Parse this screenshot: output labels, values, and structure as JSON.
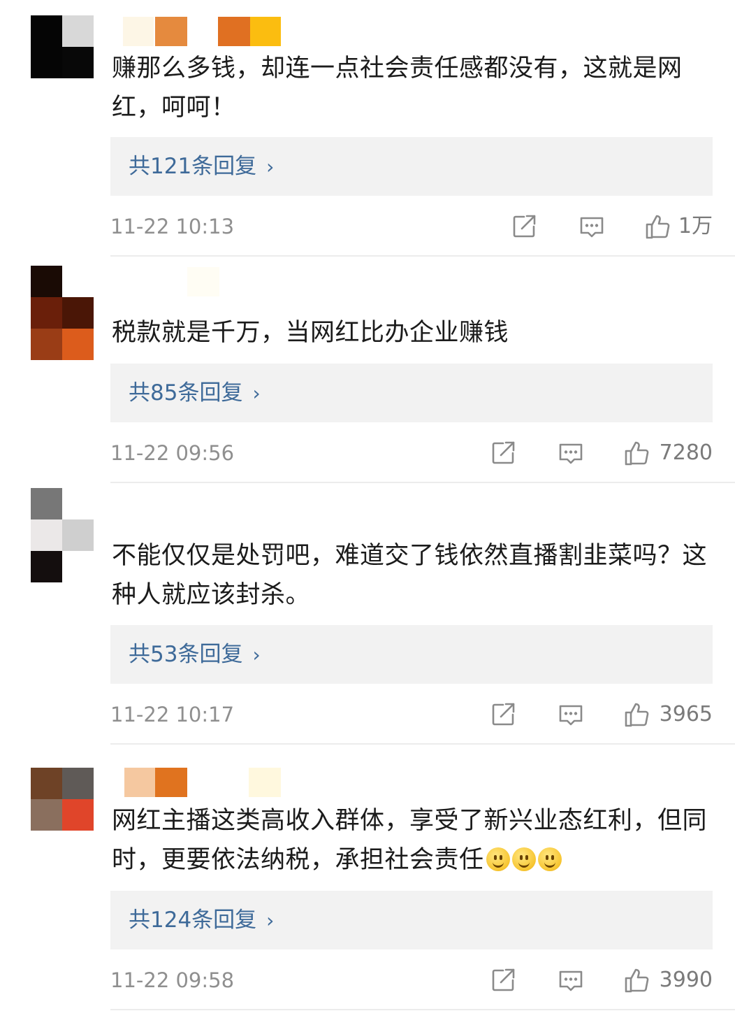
{
  "comments": [
    {
      "text": "赚那么多钱，却连一点社会责任感都没有，这就是网红，呵呵！",
      "reply_label": "共121条回复",
      "time": "11-22 10:13",
      "likes": "1万",
      "avatar_colors": [
        "#050505",
        "#d8d8d8",
        "#050505",
        "#080808"
      ],
      "name_colors": [
        "#fdf6e6",
        "#e58a3e",
        "#e07022",
        "#fbbd10"
      ]
    },
    {
      "text": "税款就是千万，当网红比办企业赚钱",
      "reply_label": "共85条回复",
      "time": "11-22 09:56",
      "likes": "7280",
      "avatar_colors": [
        "#1a0b05",
        "#ffffff",
        "#6a1f0a",
        "#4a1606",
        "#9a3d16",
        "#dc5c1c"
      ],
      "name_colors": [
        "#fffdf4"
      ]
    },
    {
      "text": "不能仅仅是处罚吧，难道交了钱依然直播割韭菜吗？这种人就应该封杀。",
      "reply_label": "共53条回复",
      "time": "11-22 10:17",
      "likes": "3965",
      "avatar_colors": [
        "#777777",
        "#ffffff",
        "#ebe8e8",
        "#cfcfcf",
        "#140e0e",
        "#ffffff"
      ],
      "name_colors": []
    },
    {
      "text": "网红主播这类高收入群体，享受了新兴业态红利，但同时，更要依法纳税，承担社会责任",
      "emoji_count": 3,
      "reply_label": "共124条回复",
      "time": "11-22 09:58",
      "likes": "3990",
      "avatar_colors": [
        "#6e4226",
        "#5f5a57",
        "#8a6f5e",
        "#e0452a"
      ],
      "name_colors": [
        "#f5c8a0",
        "#e0731f",
        "#fff8de"
      ]
    }
  ],
  "icons": {
    "share": "share-icon",
    "comment": "comment-icon",
    "like": "thumbs-up-icon",
    "chevron": "chevron-right-icon",
    "emoji": "smile-emoji-icon"
  },
  "colors": {
    "link": "#3e6a99",
    "meta": "#8f8f8f",
    "reply_bg": "#f2f2f2"
  }
}
